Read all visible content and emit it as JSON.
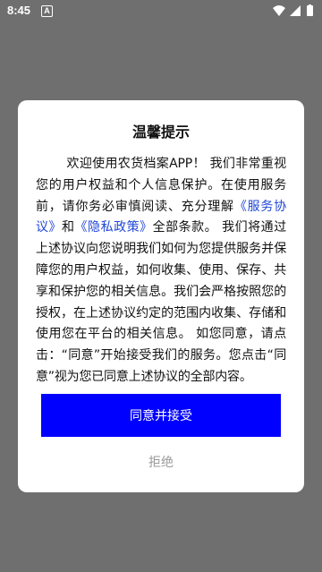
{
  "status_bar": {
    "time": "8:45",
    "notification_letter": "A"
  },
  "dialog": {
    "title": "温馨提示",
    "body": {
      "intro": "欢迎使用农货档案APP！ 我们非常重视您的用户权益和个人信息保护。在使用服务前，请你务必审慎阅读、充分理解",
      "service_link": "《服务协议》",
      "and": "和",
      "privacy_link": "《隐私政策》",
      "rest": "全部条款。 我们将通过上述协议向您说明我们如何为您提供服务并保障您的用户权益，如何收集、使用、保存、共享和保护您的相关信息。我们会严格按照您的授权，在上述协议约定的范围内收集、存储和使用您在平台的相关信息。 如您同意，请点击：“同意”开始接受我们的服务。您点击“同意”视为您已同意上述协议的全部内容。"
    },
    "agree_label": "同意并接受",
    "reject_label": "拒绝"
  },
  "colors": {
    "overlay": "#6f6f6f",
    "primary_button": "#0000ff",
    "link": "#2147d6",
    "reject_text": "#999999"
  }
}
